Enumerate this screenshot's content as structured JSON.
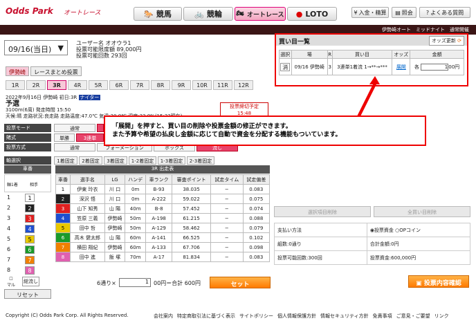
{
  "header": {
    "logo": "Odds Park",
    "logo_sub": "オートレース",
    "nav": [
      {
        "label": "競馬",
        "icon": "horse-icon"
      },
      {
        "label": "競輪",
        "icon": "bicycle-icon"
      },
      {
        "label": "オートレース",
        "icon": "motorbike-icon"
      },
      {
        "label": "LOTO",
        "icon": "ball-icon"
      }
    ],
    "actions": [
      "入金・精算",
      "照会",
      "よくある質問"
    ],
    "dark_bar": "伊勢崎オート　ミッドナイト　通常開催"
  },
  "date": "09/16(当日)",
  "user": {
    "l1": "ユーザー名 オオウラ1",
    "l2": "投票可能限度額 89,000円",
    "l3": "投票可能回数 293回"
  },
  "tabs": [
    "伊勢崎",
    "レースまとめ投票"
  ],
  "races": [
    "1R",
    "2R",
    "3R",
    "4R",
    "5R",
    "6R",
    "7R",
    "8R",
    "9R",
    "10R",
    "11R",
    "12R"
  ],
  "raceinfo": {
    "l1": "2022年9月16日 伊勢崎 初日:3R",
    "badge": "ナイター",
    "title": "予選",
    "l2": "3100m(6周) 発走時間 15:50",
    "l3": "天候:晴 走路状況:良走路 走路温度:47.0℃ 気温:30.0℃ 湿度:33.0%(15:23現在)",
    "deadline_label": "投票締切予定",
    "deadline_time": "15:48"
  },
  "mode": {
    "label": "投票モード",
    "opts": [
      "通常",
      "",
      "ながし"
    ]
  },
  "type": {
    "label": "賭式",
    "opts": [
      "単勝",
      "",
      "3連単"
    ]
  },
  "method": {
    "label": "投票方式",
    "opts": [
      "通常",
      "フォーメーション",
      "ボックス",
      "流し"
    ]
  },
  "axis": {
    "label": "軸選択",
    "opts": [
      "1着固定",
      "2着固定",
      "3着固定",
      "1-2着固定",
      "1-3着固定",
      "2-3着固定"
    ]
  },
  "table": {
    "title": "3R 出走表",
    "left_head": "車番",
    "cols": [
      "車番",
      "選手名",
      "LG",
      "ハンデ",
      "車ランク",
      "審査ポイント",
      "試走タイム",
      "試走偏差"
    ],
    "sub_cols": [
      "軸1着",
      "相手"
    ],
    "rows": [
      [
        "1",
        "伊東 玲衣",
        "川 口",
        "0m",
        "B-93",
        "38.035",
        "−",
        "0.083"
      ],
      [
        "2",
        "深沢 悟",
        "川 口",
        "0m",
        "A-222",
        "59.022",
        "−",
        "0.075"
      ],
      [
        "3",
        "山下 知秀",
        "山 陽",
        "40m",
        "B-8",
        "57.452",
        "−",
        "0.074"
      ],
      [
        "4",
        "笠原 三義",
        "伊勢崎",
        "50m",
        "A-198",
        "61.215",
        "−",
        "0.088"
      ],
      [
        "5",
        "田中 哲",
        "伊勢崎",
        "50m",
        "A-129",
        "58.462",
        "−",
        "0.079"
      ],
      [
        "6",
        "高木 健太郎",
        "山 陽",
        "60m",
        "A-141",
        "66.525",
        "−",
        "0.102"
      ],
      [
        "7",
        "横田 翔紀",
        "伊勢崎",
        "60m",
        "A-133",
        "67.706",
        "−",
        "0.098"
      ],
      [
        "8",
        "田中 進",
        "飯 塚",
        "70m",
        "A-17",
        "81.834",
        "−",
        "0.083"
      ]
    ]
  },
  "colors": [
    "#ffffff",
    "#222222",
    "#e02020",
    "#1f4fd0",
    "#e8c800",
    "#1a9a2a",
    "#f08000",
    "#e060b0"
  ],
  "left_bottom": {
    "multi": "マルチ",
    "box": "総流し",
    "reset": "リセット"
  },
  "bottom": {
    "count": "6通り×",
    "amount": "1",
    "result": "00円＝合計 600円",
    "set": "セット"
  },
  "panel": {
    "title": "買い目一覧",
    "update": "オッズ更新",
    "cols": [
      "選択",
      "場",
      "R",
      "買い目",
      "オッズ",
      "金額"
    ],
    "row": {
      "del": "消",
      "place": "09/16 伊勢崎",
      "r": "3",
      "bet": "3連単1着流 1→**→***",
      "odds": "展開",
      "each": "各",
      "amount": "1",
      "unit": "00円"
    }
  },
  "callout": {
    "l1": "「展開」を押すと、買い目の削除や投票金額の修正ができます。",
    "l2": "また予算や希望の払戻し金額に応じて自動で資金を分配する機能もついています。"
  },
  "right": {
    "del_sel": "選択項目削除",
    "del_all": "全買い目削除",
    "pay_method": "支払い方法",
    "pay_opt1": "投票資金",
    "pay_opt2": "OPコイン",
    "count": "組数:0通り",
    "total": "合計金額:0円",
    "possible": "投票可能回数:300回",
    "fund": "投票資金:600,000円",
    "confirm": "投票内容確認"
  },
  "footer": {
    "copy": "Copyright (C) Odds Park Corp. All Rights Reserved.",
    "links": [
      "会社案内",
      "特定商取引法に基づく表示",
      "サイトポリシー",
      "個人情報保護方針",
      "情報セキュリティ方針",
      "免責事項",
      "ご意見・ご要望",
      "リンク"
    ]
  }
}
